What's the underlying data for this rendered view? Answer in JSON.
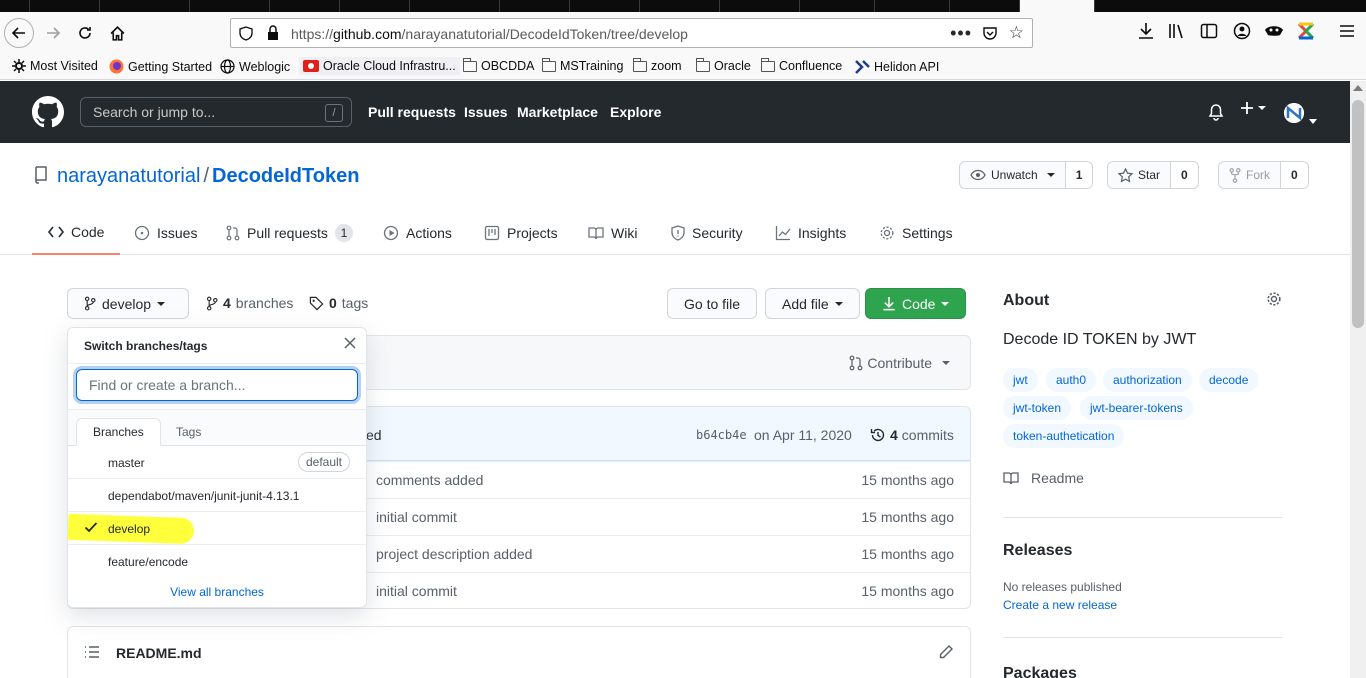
{
  "browser": {
    "url_prefix": "https://",
    "url_domain": "github.com",
    "url_path": "/narayanatutorial/DecodeIdToken/tree/develop",
    "more_label": "•••",
    "bookmarks": [
      "Most Visited",
      "Getting Started",
      "Weblogic",
      "Oracle Cloud Infrastru...",
      "OBCDDA",
      "MSTraining",
      "zoom",
      "Oracle",
      "Confluence",
      "Helidon API"
    ]
  },
  "github": {
    "search_placeholder": "Search or jump to...",
    "search_key": "/",
    "nav": [
      "Pull requests",
      "Issues",
      "Marketplace",
      "Explore"
    ]
  },
  "repo": {
    "owner": "narayanatutorial",
    "separator": "/",
    "name": "DecodeIdToken",
    "watch_label": "Unwatch",
    "watch_count": "1",
    "star_label": "Star",
    "star_count": "0",
    "fork_label": "Fork",
    "fork_count": "0"
  },
  "tabs": [
    {
      "label": "Code"
    },
    {
      "label": "Issues"
    },
    {
      "label": "Pull requests",
      "count": "1"
    },
    {
      "label": "Actions"
    },
    {
      "label": "Projects"
    },
    {
      "label": "Wiki"
    },
    {
      "label": "Security"
    },
    {
      "label": "Insights"
    },
    {
      "label": "Settings"
    }
  ],
  "filenav": {
    "branch": "develop",
    "branches_count": "4",
    "branches_label": "branches",
    "tags_count": "0",
    "tags_label": "tags",
    "goto_file": "Go to file",
    "add_file": "Add file",
    "code": "Code",
    "contribute": "Contribute"
  },
  "commit": {
    "message_tail": "ed",
    "sha": "b64cb4e",
    "date": "on Apr 11, 2020",
    "count": "4",
    "count_label": "commits"
  },
  "files": [
    {
      "message": "comments added",
      "age": "15 months ago"
    },
    {
      "message": "initial commit",
      "age": "15 months ago"
    },
    {
      "message": "project description added",
      "age": "15 months ago"
    },
    {
      "message": "initial commit",
      "age": "15 months ago"
    }
  ],
  "readme": {
    "title": "README.md"
  },
  "dropdown": {
    "title": "Switch branches/tags",
    "filter_placeholder": "Find or create a branch...",
    "tab_branches": "Branches",
    "tab_tags": "Tags",
    "branches": [
      {
        "name": "master",
        "badge": "default"
      },
      {
        "name": "dependabot/maven/junit-junit-4.13.1"
      },
      {
        "name": "develop",
        "selected": true
      },
      {
        "name": "feature/encode"
      }
    ],
    "view_all": "View all branches"
  },
  "sidebar": {
    "about_title": "About",
    "description": "Decode ID TOKEN by JWT",
    "topics": [
      "jwt",
      "auth0",
      "authorization",
      "decode",
      "jwt-token",
      "jwt-bearer-tokens",
      "token-authetication"
    ],
    "readme_label": "Readme",
    "releases_title": "Releases",
    "no_releases": "No releases published",
    "create_release": "Create a new release",
    "packages_title": "Packages"
  },
  "colors": {
    "header_bg": "#24292e",
    "link": "#0366d6",
    "green_button": "#2ea44f",
    "active_tab_underline": "#f9826c",
    "highlight": "#ffff3c"
  }
}
